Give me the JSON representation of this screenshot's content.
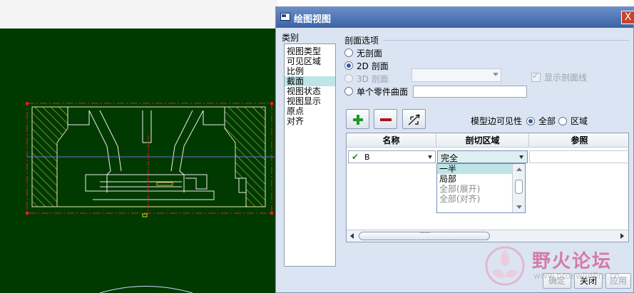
{
  "dialog": {
    "title": "绘图视图",
    "close_label": "X"
  },
  "categories": {
    "label": "类别",
    "items": [
      "视图类型",
      "可见区域",
      "比例",
      "截面",
      "视图状态",
      "视图显示",
      "原点",
      "对齐"
    ],
    "selected_index": 3
  },
  "section_options": {
    "label": "剖面选项",
    "radios": [
      {
        "label": "无剖面",
        "checked": false,
        "disabled": false
      },
      {
        "label": "2D 剖面",
        "checked": true,
        "disabled": false
      },
      {
        "label": "3D 剖面",
        "checked": false,
        "disabled": true
      },
      {
        "label": "单个零件曲面",
        "checked": false,
        "disabled": false
      }
    ],
    "show_section_lines": "显示剖面线"
  },
  "toolbar": {
    "visibility_label": "模型边可见性",
    "visibility_all": "全部",
    "visibility_area": "区域"
  },
  "table": {
    "headers": [
      "名称",
      "剖切区域",
      "参照"
    ],
    "row": {
      "name": "B",
      "area": "完全"
    },
    "area_options": [
      "一半",
      "局部",
      "全部(展开)",
      "全部(对齐)"
    ],
    "scroll_grip": "....."
  },
  "buttons": {
    "ok": "确定",
    "close": "关闭",
    "apply": "应用"
  },
  "watermark": {
    "title": "野火论坛",
    "sub": "www.proewildfire.cn"
  },
  "colors": {
    "cad_background": "#003a00",
    "titlebar": "#3b63a5",
    "selection": "#bde5e6",
    "dialog_bg": "#dbe4f2"
  }
}
